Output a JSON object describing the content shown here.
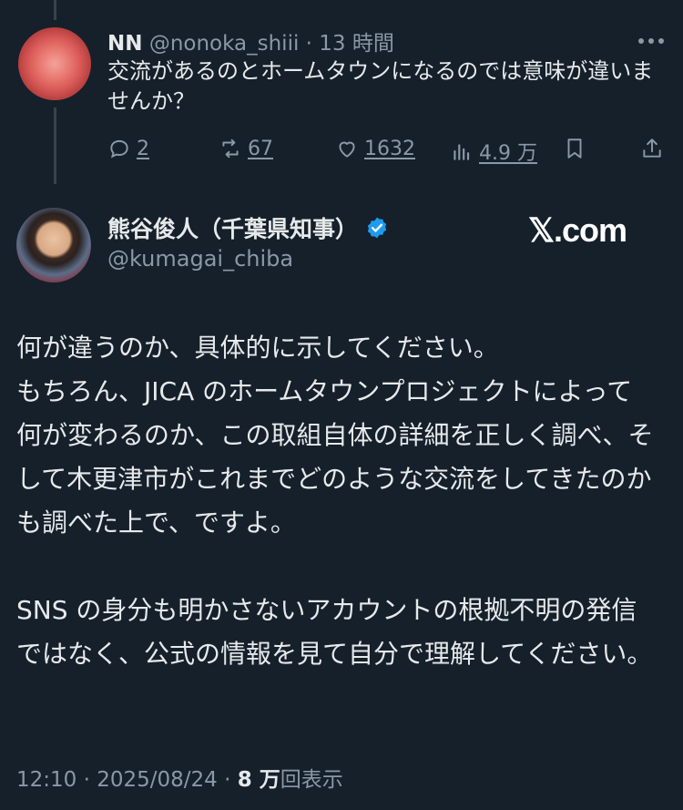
{
  "reply": {
    "name": "NN",
    "handle": "@nonoka_shiii",
    "separator": "·",
    "time": "13 時間",
    "text": "交流があるのとホームタウンになるのでは意味が違いませんか？",
    "actions": {
      "replies": "2",
      "reposts": "67",
      "likes": "1632",
      "views": "4.9 万"
    }
  },
  "tweet": {
    "name": "熊谷俊人（千葉県知事）",
    "handle": "@kumagai_chiba",
    "paragraph1": "何が違うのか、具体的に示してください。\nもちろん、JICA のホームタウンプロジェクトによって何が変わるのか、この取組自体の詳細を正しく調べ、そして木更津市がこれまでどのような交流をしてきたのかも調べた上で、ですよ。",
    "paragraph2": "SNS の身分も明かさないアカウントの根拠不明の発信ではなく、公式の情報を見て自分で理解してください。",
    "time": "12:10",
    "date": "2025/08/24",
    "views_count": "8 万",
    "views_label": "回表示"
  },
  "watermark": "𝕏.com",
  "icons": [
    "more-icon",
    "reply-icon",
    "repost-icon",
    "like-icon",
    "views-icon",
    "bookmark-icon",
    "share-icon",
    "verified-icon"
  ],
  "colors": {
    "background": "#15202b",
    "text": "#e7e9ea",
    "muted": "#8b98a5",
    "verified": "#1d9bf0"
  }
}
